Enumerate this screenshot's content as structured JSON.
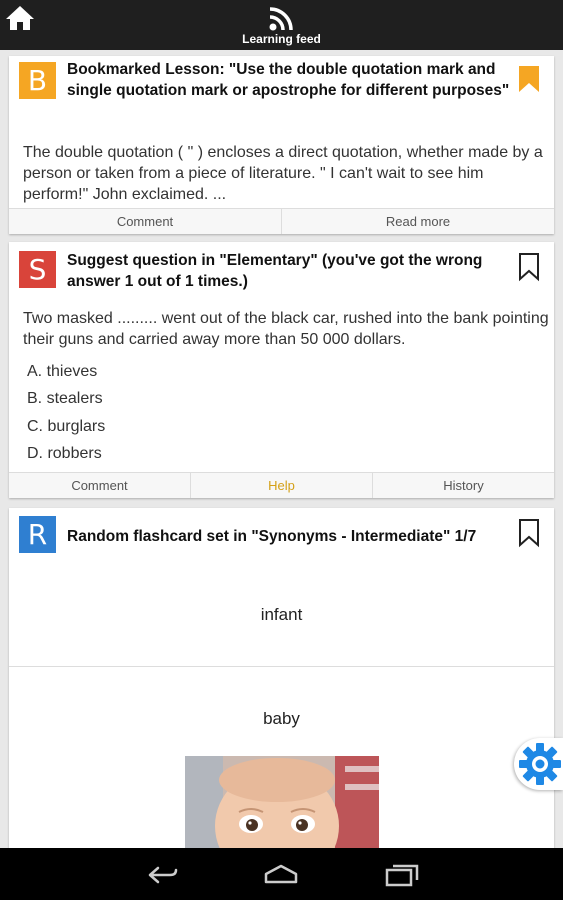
{
  "topbar": {
    "title": "Learning feed"
  },
  "cards": [
    {
      "badge": "B",
      "badge_color": "#f5a623",
      "title": "Bookmarked Lesson: \"Use the double quotation mark and single quotation mark or apostrophe for different purposes\"",
      "body": "The double quotation ( \" ) encloses a direct quotation, whether made by a person or taken from a piece of literature. \" I can't wait to see him perform!\" John exclaimed. ...",
      "actions": [
        "Comment",
        "Read more"
      ]
    },
    {
      "badge": "S",
      "badge_color": "#d9443a",
      "title": "Suggest question in \"Elementary\" (you've got the wrong answer 1 out of 1 times.)",
      "body": "Two masked ......... went out of the black car, rushed into the bank pointing their guns and carried away more than 50 000 dollars.",
      "options": [
        "A. thieves",
        "B. stealers",
        "C. burglars",
        "D. robbers"
      ],
      "actions": [
        "Comment",
        "Help",
        "History"
      ]
    },
    {
      "badge": "R",
      "badge_color": "#2f7fd1",
      "title": "Random flashcard set in \"Synonyms - Intermediate\" 1/7",
      "word_front": "infant",
      "word_back": "baby"
    }
  ],
  "colors": {
    "accent": "#f5a623",
    "help": "#d4a017"
  }
}
